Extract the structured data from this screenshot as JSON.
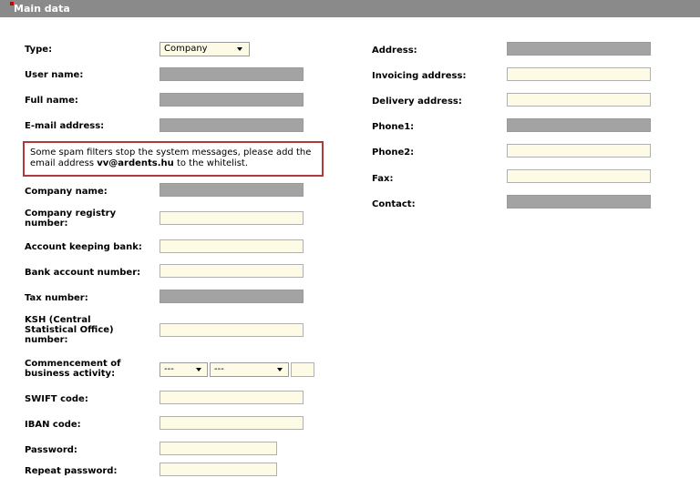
{
  "section": {
    "title": "Main data"
  },
  "left": {
    "type_label": "Type:",
    "type_value": "Company",
    "user_name_label": "User name:",
    "full_name_label": "Full name:",
    "email_label": "E-mail address:",
    "notice": {
      "text_before": "Some spam filters stop the system messages, please add the email address ",
      "email": "vv@ardents.hu",
      "text_after": " to the whitelist."
    },
    "company_name_label": "Company name:",
    "company_registry_label_1": "Company registry",
    "company_registry_label_2": "number:",
    "account_bank_label": "Account keeping bank:",
    "bank_account_label": "Bank account number:",
    "tax_number_label": "Tax number:",
    "ksh_label_1": "KSH (Central",
    "ksh_label_2": "Statistical Office)",
    "ksh_label_3": "number:",
    "commencement_label_1": "Commencement of",
    "commencement_label_2": "business activity:",
    "commencement_year": "---",
    "commencement_month": "---",
    "swift_label": "SWIFT code:",
    "iban_label": "IBAN code:",
    "password_label": "Password:",
    "repeat_password_label": "Repeat password:"
  },
  "right": {
    "address_label": "Address:",
    "invoicing_label": "Invoicing address:",
    "delivery_label": "Delivery address:",
    "phone1_label": "Phone1:",
    "phone2_label": "Phone2:",
    "fax_label": "Fax:",
    "contact_label": "Contact:"
  },
  "colors": {
    "header": "#8a8a8a",
    "disabled_field": "#a3a3a3",
    "editable_field": "#fdfbe6",
    "notice_border": "#b03a3a"
  }
}
